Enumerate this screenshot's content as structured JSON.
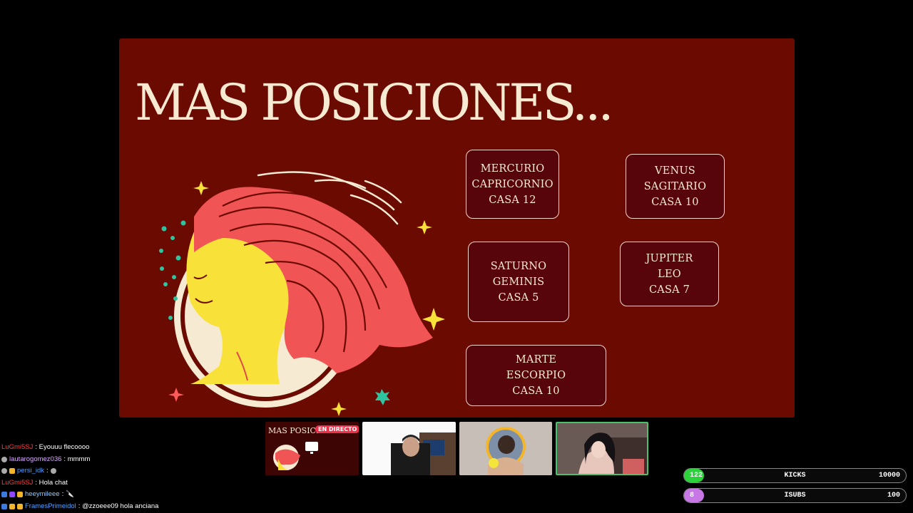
{
  "slide": {
    "title": "MAS POSICIONES...",
    "boxes": [
      {
        "planet": "MERCURIO",
        "sign": "CAPRICORNIO",
        "house": "CASA 12"
      },
      {
        "planet": "VENUS",
        "sign": "SAGITARIO",
        "house": "CASA 10"
      },
      {
        "planet": "SATURNO",
        "sign": "GEMINIS",
        "house": "CASA 5"
      },
      {
        "planet": "JUPITER",
        "sign": "LEO",
        "house": "CASA 7"
      },
      {
        "planet": "MARTE",
        "sign": "ESCORPIO",
        "house": "CASA 10"
      }
    ],
    "colors": {
      "background": "#6b0a00",
      "text": "#f6ead2",
      "hair": "#f05454",
      "face": "#f8e23a",
      "halo": "#f6ead2"
    }
  },
  "scenes": {
    "thumb1_title": "MAS POSICIO",
    "live_badge": "EN DIRECTO"
  },
  "chat": [
    {
      "user": "LuGmi5SJ",
      "message": ": Eyouuu flecoooo"
    },
    {
      "user": "lautarogomez036",
      "message": ": mmmm"
    },
    {
      "user": "persi_idk",
      "message": ":"
    },
    {
      "user": "LuGmi5SJ",
      "message": ": Hola chat"
    },
    {
      "user": "heeymileee",
      "message": ":"
    },
    {
      "user": "FramesPrimeidol",
      "message": ": @zzoeee09 hola anciana"
    }
  ],
  "goals": {
    "kicks": {
      "current": "122",
      "label": "KICKS",
      "target": "10000",
      "progress": 0.0122,
      "color": "#2bd23a"
    },
    "subs": {
      "current": "8",
      "label": "ISUBS",
      "target": "100",
      "progress": 0.08,
      "color": "#c777e6"
    }
  }
}
